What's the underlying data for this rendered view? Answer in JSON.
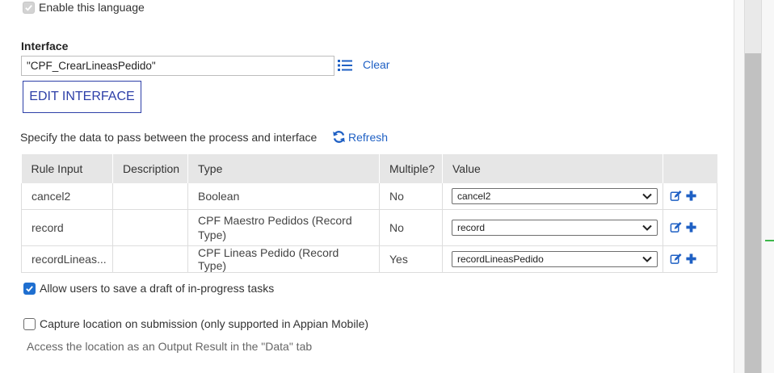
{
  "enable_language": {
    "label": "Enable this language",
    "checked": true,
    "disabled": true
  },
  "interface": {
    "label": "Interface",
    "value": "\"CPF_CrearLineasPedido\"",
    "list_icon": "list-icon",
    "clear_label": "Clear",
    "edit_button": "EDIT INTERFACE"
  },
  "data_section": {
    "description": "Specify the data to pass between the process and interface",
    "refresh_label": "Refresh",
    "refresh_icon": "refresh-icon"
  },
  "table": {
    "headers": [
      "Rule Input",
      "Description",
      "Type",
      "Multiple?",
      "Value"
    ],
    "rows": [
      {
        "rule_input": "cancel2",
        "description": "",
        "type": "Boolean",
        "multiple": "No",
        "value": "cancel2"
      },
      {
        "rule_input": "record",
        "description": "",
        "type": "CPF Maestro Pedidos (Record Type)",
        "multiple": "No",
        "value": "record"
      },
      {
        "rule_input": "recordLineas...",
        "description": "",
        "type": "CPF Lineas Pedido (Record Type)",
        "multiple": "Yes",
        "value": "recordLineasPedido"
      }
    ],
    "row_icons": [
      "edit-icon",
      "plus-icon"
    ]
  },
  "allow_draft": {
    "label": "Allow users to save a draft of in-progress tasks",
    "checked": true
  },
  "capture_location": {
    "label": "Capture location on submission (only supported in Appian Mobile)",
    "checked": false,
    "help": "Access the location as an Output Result in the \"Data\" tab"
  },
  "colors": {
    "link": "#1f60c4",
    "button_border": "#2d3fa8",
    "checkbox": "#1f6fd0",
    "header_bg": "#e6e6e6"
  }
}
